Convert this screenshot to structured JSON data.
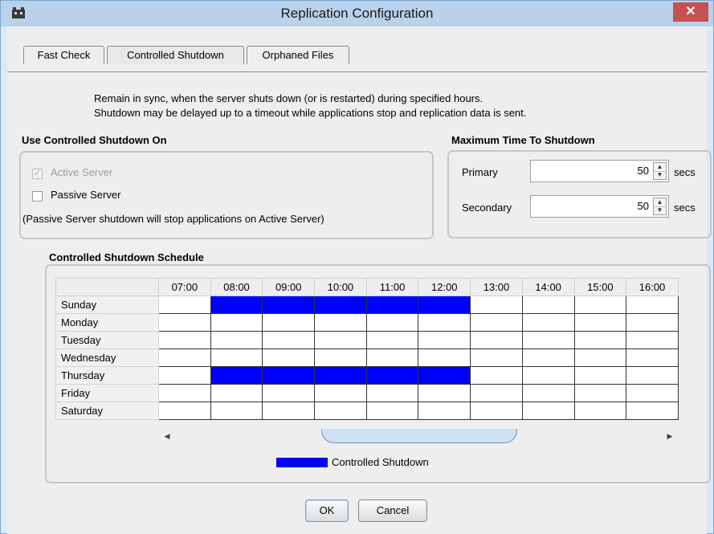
{
  "window": {
    "title": "Replication Configuration",
    "close_glyph": "✕"
  },
  "tabs": [
    {
      "label": "Fast Check",
      "selected": false
    },
    {
      "label": "Controlled Shutdown",
      "selected": true
    },
    {
      "label": "Orphaned Files",
      "selected": false
    }
  ],
  "description": {
    "line1": "Remain in sync, when the server shuts down (or is restarted) during specified hours.",
    "line2": "Shutdown may be delayed up to a timeout while applications stop and replication data is sent."
  },
  "use_on": {
    "title": "Use Controlled Shutdown On",
    "active_server": {
      "label": "Active Server",
      "checked": true,
      "enabled": false
    },
    "passive_server": {
      "label": "Passive Server",
      "checked": false,
      "enabled": true
    },
    "note": "(Passive Server shutdown will stop applications on Active Server)"
  },
  "max_time": {
    "title": "Maximum Time To Shutdown",
    "primary": {
      "label": "Primary",
      "value": "50",
      "unit": "secs"
    },
    "secondary": {
      "label": "Secondary",
      "value": "50",
      "unit": "secs"
    }
  },
  "schedule": {
    "title": "Controlled Shutdown Schedule",
    "hours": [
      "07:00",
      "08:00",
      "09:00",
      "10:00",
      "11:00",
      "12:00",
      "13:00",
      "14:00",
      "15:00",
      "16:00"
    ],
    "rows": [
      {
        "day": "Sunday",
        "on": [
          false,
          true,
          true,
          true,
          true,
          true,
          false,
          false,
          false,
          false
        ]
      },
      {
        "day": "Monday",
        "on": [
          false,
          false,
          false,
          false,
          false,
          false,
          false,
          false,
          false,
          false
        ]
      },
      {
        "day": "Tuesday",
        "on": [
          false,
          false,
          false,
          false,
          false,
          false,
          false,
          false,
          false,
          false
        ]
      },
      {
        "day": "Wednesday",
        "on": [
          false,
          false,
          false,
          false,
          false,
          false,
          false,
          false,
          false,
          false
        ]
      },
      {
        "day": "Thursday",
        "on": [
          false,
          true,
          true,
          true,
          true,
          true,
          false,
          false,
          false,
          false
        ]
      },
      {
        "day": "Friday",
        "on": [
          false,
          false,
          false,
          false,
          false,
          false,
          false,
          false,
          false,
          false
        ]
      },
      {
        "day": "Saturday",
        "on": [
          false,
          false,
          false,
          false,
          false,
          false,
          false,
          false,
          false,
          false
        ]
      }
    ],
    "legend_label": "Controlled Shutdown",
    "active_color": "#0000ff"
  },
  "buttons": {
    "ok": "OK",
    "cancel": "Cancel"
  }
}
